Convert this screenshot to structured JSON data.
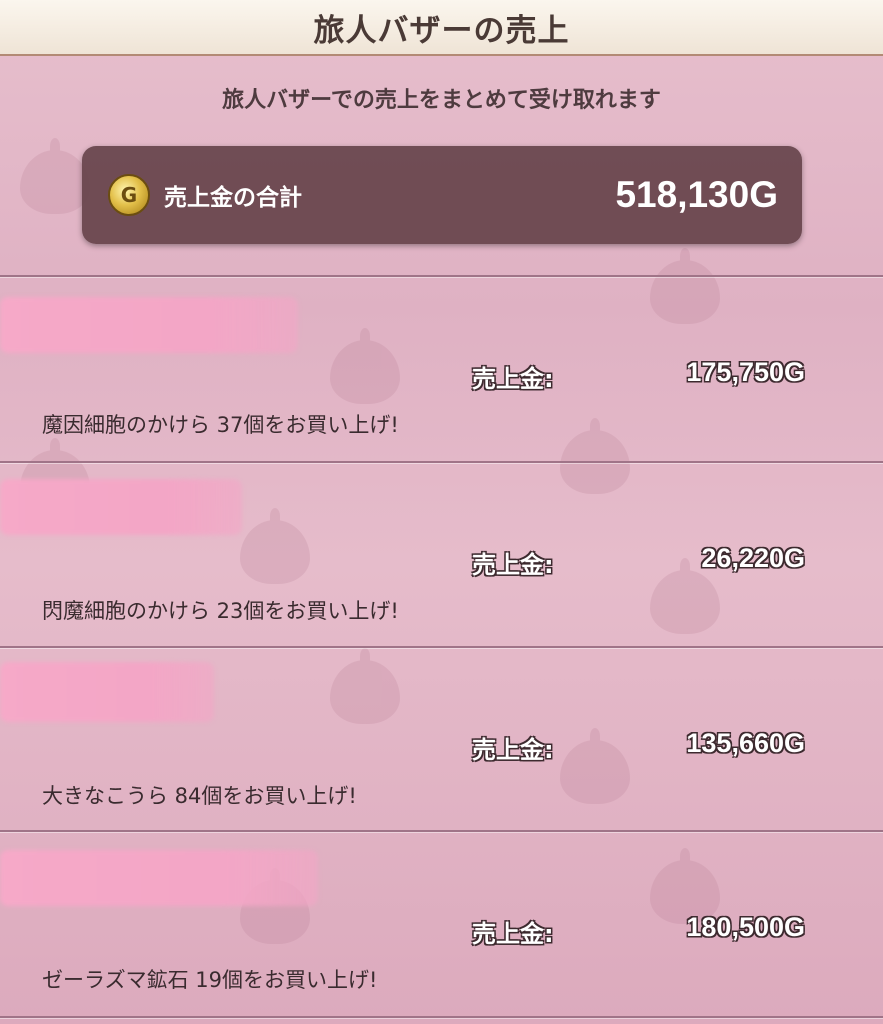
{
  "header": {
    "title": "旅人バザーの売上"
  },
  "subtitle": "旅人バザーでの売上をまとめて受け取れます",
  "total": {
    "coin_icon": "G",
    "label": "売上金の合計",
    "value": "518,130G"
  },
  "sales": [
    {
      "label": "売上金:",
      "amount": "175,750G",
      "description": "魔因細胞のかけら  37個をお買い上げ!"
    },
    {
      "label": "売上金:",
      "amount": "26,220G",
      "description": "閃魔細胞のかけら  23個をお買い上げ!"
    },
    {
      "label": "売上金:",
      "amount": "135,660G",
      "description": "大きなこうら  84個をお買い上げ!"
    },
    {
      "label": "売上金:",
      "amount": "180,500G",
      "description": "ゼーラズマ鉱石  19個をお買い上げ!"
    }
  ],
  "colors": {
    "background": "#e2b6c6",
    "header": "#f5ede3",
    "panel": "#603e44",
    "redaction": "#f4a7c6"
  }
}
